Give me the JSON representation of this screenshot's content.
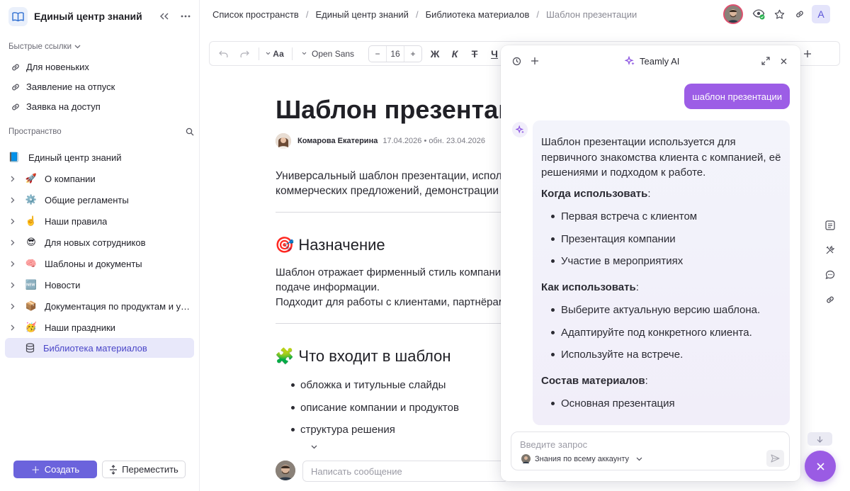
{
  "sidebar": {
    "title": "Единый центр знаний",
    "quick_links_label": "Быстрые ссылки",
    "quick_links": [
      {
        "label": "Для новеньких"
      },
      {
        "label": "Заявление на отпуск"
      },
      {
        "label": "Заявка на доступ"
      }
    ],
    "space_label": "Пространство",
    "root": {
      "label": "Единый центр знаний",
      "emoji": "📘"
    },
    "items": [
      {
        "label": "О компании",
        "emoji": "🚀"
      },
      {
        "label": "Общие регламенты",
        "emoji": "⚙️"
      },
      {
        "label": "Наши правила",
        "emoji": "☝️"
      },
      {
        "label": "Для новых сотрудников",
        "emoji": "😎"
      },
      {
        "label": "Шаблоны и документы",
        "emoji": "🧠"
      },
      {
        "label": "Новости",
        "emoji": "🆕"
      },
      {
        "label": "Документация по продуктам и усл...",
        "emoji": "📦"
      },
      {
        "label": "Наши праздники",
        "emoji": "🥳"
      }
    ],
    "active_item": {
      "label": "Библиотека материалов"
    },
    "create_label": "Создать",
    "move_label": "Переместить"
  },
  "breadcrumbs": [
    "Список пространств",
    "Единый центр знаний",
    "Библиотека материалов",
    "Шаблон презентации"
  ],
  "user_initial": "A",
  "toolbar": {
    "font": "Open Sans",
    "font_size": "16",
    "bold": "Ж",
    "italic": "К",
    "strike": "Т",
    "underline": "Ч",
    "text_style": "Аа"
  },
  "document": {
    "title": "Шаблон презентации",
    "author": "Комарова Екатерина",
    "dates": "17.04.2026 • обн. 23.04.2026",
    "intro_lines": [
      "Универсальный шаблон презентации, используемый для",
      "коммерческих предложений, демонстрации решений"
    ],
    "section1": {
      "emoji": "🎯",
      "heading": "Назначение",
      "lines": [
        "Шаблон отражает фирменный стиль компании",
        "подаче информации.",
        "Подходит для работы с клиентами, партнёрами"
      ]
    },
    "section2": {
      "emoji": "🧩",
      "heading": "Что входит в шаблон",
      "bullets": [
        "обложка и титульные слайды",
        "описание компании и продуктов",
        "структура решения"
      ]
    },
    "comment_placeholder": "Написать сообщение"
  },
  "ai_panel": {
    "title": "Teamly AI",
    "user_message": "шаблон презентации",
    "answer": {
      "intro": "Шаблон презентации используется для первичного знакомства клиента с компанией, её решениями и подходом к работе.",
      "when_label": "Когда использовать",
      "when_items": [
        "Первая встреча с клиентом",
        "Презентация компании",
        "Участие в мероприятиях"
      ],
      "how_label": "Как использовать",
      "how_items": [
        "Выберите актуальную версию шаблона.",
        "Адаптируйте под конкретного клиента.",
        "Используйте на встрече."
      ],
      "contents_label": "Состав материалов",
      "contents_items": [
        "Основная презентация"
      ]
    },
    "input_placeholder": "Введите запрос",
    "scope_label": "Знания по всему аккаунту"
  },
  "colors": {
    "accent": "#6b63dc",
    "ai_purple": "#9c5de6",
    "active_bg": "#e8e8fa"
  }
}
